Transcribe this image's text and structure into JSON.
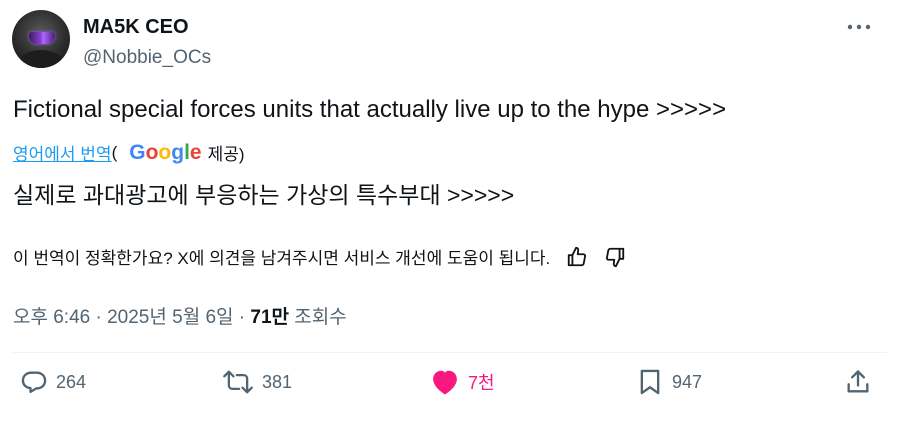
{
  "author": {
    "display_name": "MA5K CEO",
    "handle": "@Nobbie_OCs"
  },
  "tweet": {
    "text": "Fictional special forces units that actually live up to the hype >>>>>",
    "translate_link": "영어에서 번역",
    "provider_open": "(",
    "provider_letters": [
      "G",
      "o",
      "o",
      "g",
      "l",
      "e"
    ],
    "provider_suffix": "제공)",
    "translated_text": "실제로 과대광고에 부응하는 가상의 특수부대 >>>>>",
    "feedback_prompt": "이 번역이 정확한가요? X에 의견을 남겨주시면 서비스 개선에 도움이 됩니다."
  },
  "meta": {
    "time_date": "오후 6:46 · 2025년 5월 6일 · ",
    "views_count": "71만",
    "views_label": " 조회수"
  },
  "actions": {
    "replies": "264",
    "retweets": "381",
    "likes": "7천",
    "bookmarks": "947"
  },
  "colors": {
    "accent": "#1d9bf0",
    "like": "#f91880",
    "secondary_text": "#536471"
  },
  "icons": [
    "more-icon",
    "thumbs-up-icon",
    "thumbs-down-icon",
    "reply-icon",
    "retweet-icon",
    "like-icon",
    "bookmark-icon",
    "share-icon"
  ]
}
